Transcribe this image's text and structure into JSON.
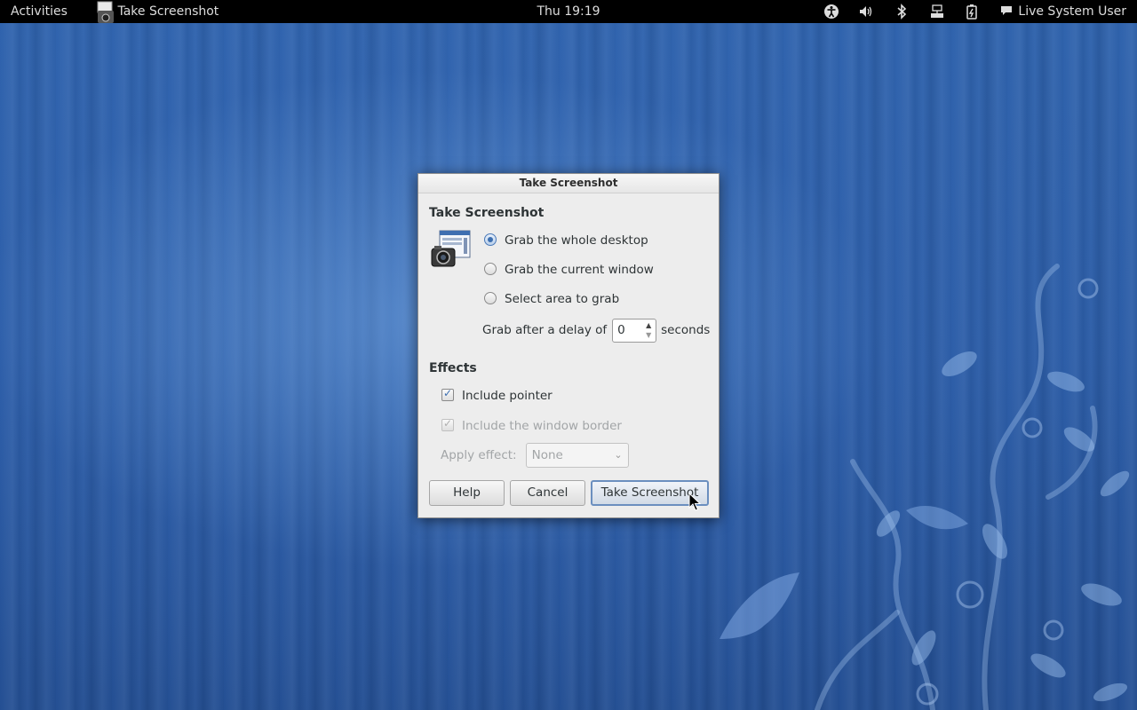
{
  "topbar": {
    "activities": "Activities",
    "app_name": "Take Screenshot",
    "clock": "Thu 19:19",
    "user": "Live System User",
    "tray_icons": [
      "accessibility-icon",
      "volume-icon",
      "bluetooth-icon",
      "network-icon",
      "battery-icon"
    ]
  },
  "dialog": {
    "title": "Take Screenshot",
    "section_take": "Take Screenshot",
    "options": [
      {
        "label": "Grab the whole desktop",
        "checked": true
      },
      {
        "label": "Grab the current window",
        "checked": false
      },
      {
        "label": "Select area to grab",
        "checked": false
      }
    ],
    "delay": {
      "prefix": "Grab after a delay of",
      "value": "0",
      "suffix": "seconds"
    },
    "section_effects": "Effects",
    "include_pointer": {
      "label": "Include pointer",
      "checked": true,
      "enabled": true
    },
    "include_border": {
      "label": "Include the window border",
      "checked": true,
      "enabled": false
    },
    "apply_effect": {
      "label": "Apply effect:",
      "value": "None",
      "enabled": false
    },
    "buttons": {
      "help": "Help",
      "cancel": "Cancel",
      "take": "Take Screenshot"
    }
  },
  "colors": {
    "desktop_blue": "#2b5ca6",
    "topbar_bg": "#000000",
    "dialog_bg": "#ededed",
    "accent": "#3d6fb0"
  }
}
